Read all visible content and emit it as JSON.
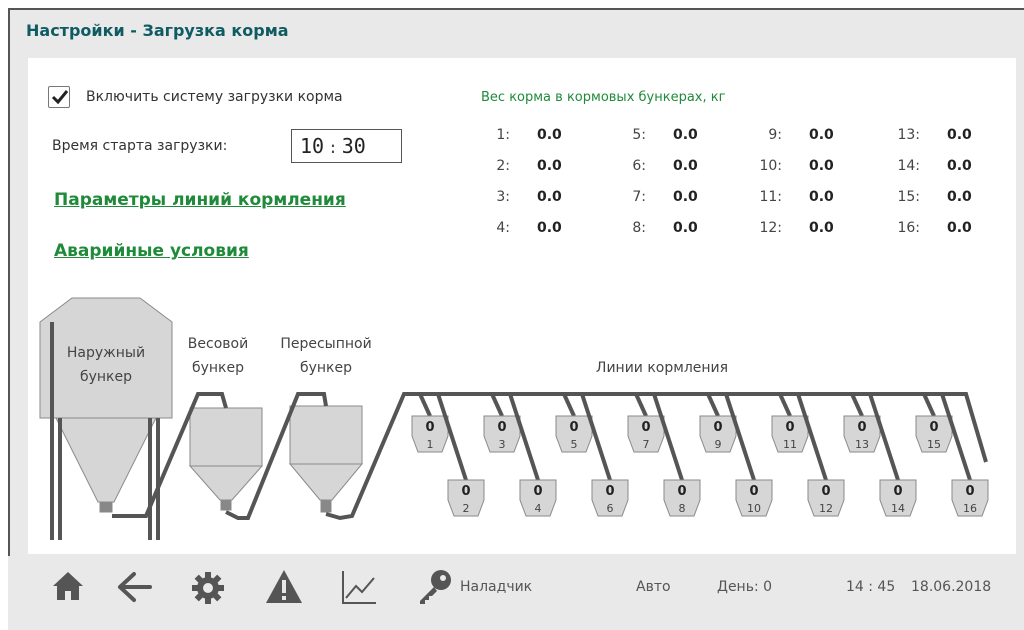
{
  "window": {
    "title": "Настройки - Загрузка корма"
  },
  "settings": {
    "enable_label": "Включить систему загрузки корма",
    "enable_checked": true,
    "start_time_label": "Время старта загрузки:",
    "start_time_hours": "10",
    "start_time_sep": ":",
    "start_time_minutes": "30",
    "link_lines": "Параметры линий кормления",
    "link_alarm": "Аварийные условия"
  },
  "weights": {
    "title": "Вес корма в кормовых бункерах, кг",
    "items": [
      {
        "index": "1:",
        "value": "0.0"
      },
      {
        "index": "2:",
        "value": "0.0"
      },
      {
        "index": "3:",
        "value": "0.0"
      },
      {
        "index": "4:",
        "value": "0.0"
      },
      {
        "index": "5:",
        "value": "0.0"
      },
      {
        "index": "6:",
        "value": "0.0"
      },
      {
        "index": "7:",
        "value": "0.0"
      },
      {
        "index": "8:",
        "value": "0.0"
      },
      {
        "index": "9:",
        "value": "0.0"
      },
      {
        "index": "10:",
        "value": "0.0"
      },
      {
        "index": "11:",
        "value": "0.0"
      },
      {
        "index": "12:",
        "value": "0.0"
      },
      {
        "index": "13:",
        "value": "0.0"
      },
      {
        "index": "14:",
        "value": "0.0"
      },
      {
        "index": "15:",
        "value": "0.0"
      },
      {
        "index": "16:",
        "value": "0.0"
      }
    ]
  },
  "diagram": {
    "outer_bin_line1": "Наружный",
    "outer_bin_line2": "бункер",
    "weigh_bin_line1": "Весовой",
    "weigh_bin_line2": "бункер",
    "transfer_bin_line1": "Пересыпной",
    "transfer_bin_line2": "бункер",
    "lines_label": "Линии кормления",
    "feeders": [
      {
        "num": "1",
        "value": "0"
      },
      {
        "num": "2",
        "value": "0"
      },
      {
        "num": "3",
        "value": "0"
      },
      {
        "num": "4",
        "value": "0"
      },
      {
        "num": "5",
        "value": "0"
      },
      {
        "num": "6",
        "value": "0"
      },
      {
        "num": "7",
        "value": "0"
      },
      {
        "num": "8",
        "value": "0"
      },
      {
        "num": "9",
        "value": "0"
      },
      {
        "num": "10",
        "value": "0"
      },
      {
        "num": "11",
        "value": "0"
      },
      {
        "num": "12",
        "value": "0"
      },
      {
        "num": "13",
        "value": "0"
      },
      {
        "num": "14",
        "value": "0"
      },
      {
        "num": "15",
        "value": "0"
      },
      {
        "num": "16",
        "value": "0"
      }
    ]
  },
  "footer": {
    "user": "Наладчик",
    "mode": "Авто",
    "day": "День: 0",
    "time": "14 : 45",
    "date": "18.06.2018"
  },
  "icons": [
    "home-icon",
    "back-arrow-icon",
    "gear-icon",
    "warning-icon",
    "chart-icon",
    "key-icon"
  ],
  "colors": {
    "title": "#0e5b63",
    "link": "#1f8a3a",
    "pipe": "#555555",
    "bin_fill": "#d6d6d6",
    "icon": "#555555"
  }
}
